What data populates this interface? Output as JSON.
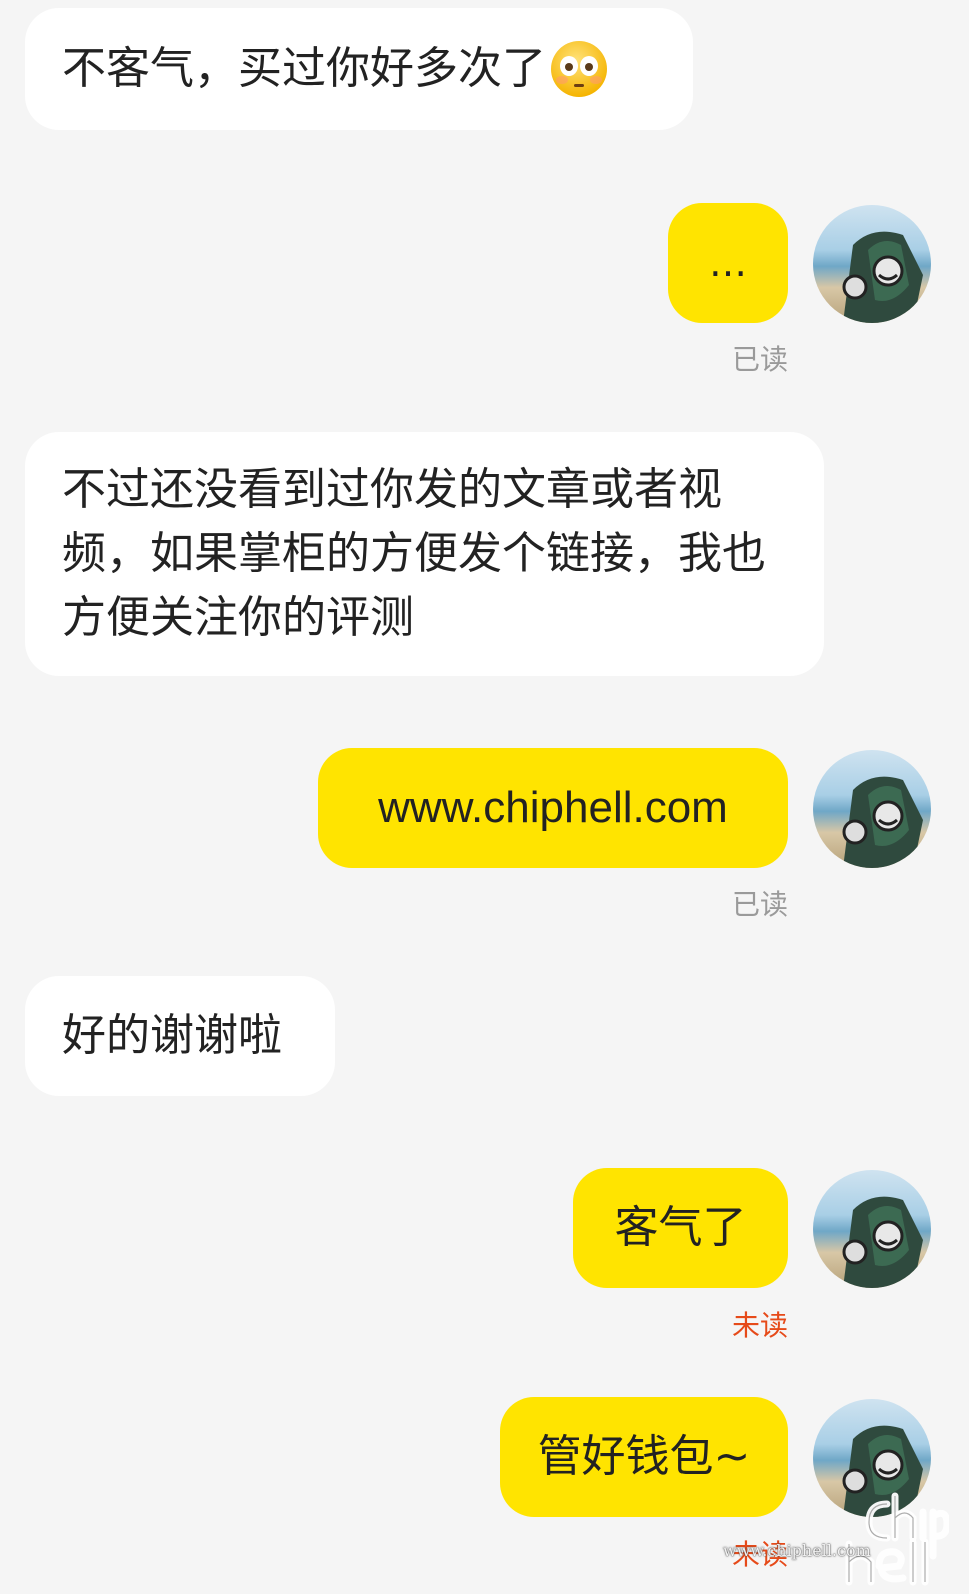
{
  "messages": [
    {
      "side": "left",
      "text": "不客气，买过你好多次了",
      "emoji": "flushed-face-emoji"
    },
    {
      "side": "right",
      "text": "…",
      "status": "已读"
    },
    {
      "side": "left",
      "text": "不过还没看到过你发的文章或者视频，如果掌柜的方便发个链接，我也方便关注你的评测"
    },
    {
      "side": "right",
      "text": "www.chiphell.com",
      "status": "已读"
    },
    {
      "side": "left",
      "text": "好的谢谢啦"
    },
    {
      "side": "right",
      "text": "客气了",
      "status": "未读"
    },
    {
      "side": "right",
      "text": "管好钱包~",
      "status": "未读"
    }
  ],
  "watermark": {
    "logo": "chip hell",
    "url": "www.chiphell.com"
  },
  "colors": {
    "background": "#f5f5f5",
    "sent_bubble": "#ffe400",
    "received_bubble": "#ffffff",
    "read_status": "#9a9a9a",
    "unread_status": "#e64a19"
  }
}
